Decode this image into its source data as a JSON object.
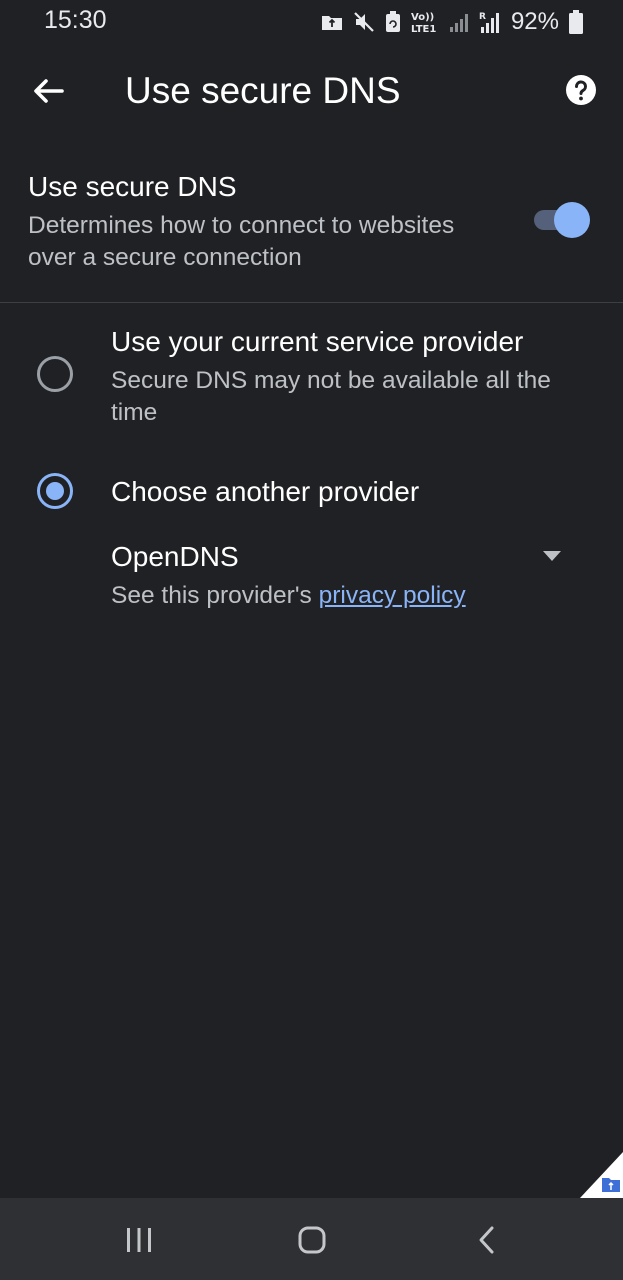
{
  "status_bar": {
    "time": "15:30",
    "battery_percent": "92%",
    "network_label_top": "Vo))",
    "network_label_bottom": "LTE1",
    "roaming_label": "R",
    "icons": [
      "notification-app-icon",
      "mute-icon",
      "battery-saver-icon",
      "volte-icon",
      "signal-sim1-icon",
      "signal-sim2-icon",
      "battery-icon"
    ]
  },
  "app_bar": {
    "title": "Use secure DNS",
    "back_icon": "arrow-back-icon",
    "help_icon": "help-icon"
  },
  "secure_dns": {
    "title": "Use secure DNS",
    "description": "Determines how to connect to websites over a secure connection",
    "enabled": true
  },
  "options": [
    {
      "label": "Use your current service provider",
      "description": "Secure DNS may not be available all the time",
      "selected": false
    },
    {
      "label": "Choose another provider",
      "selected": true
    }
  ],
  "provider": {
    "selected": "OpenDNS",
    "note_prefix": "See this provider's ",
    "link_text": "privacy policy"
  },
  "nav_bar": {
    "buttons": [
      "recents-icon",
      "home-icon",
      "back-icon"
    ]
  },
  "colors": {
    "background": "#202124",
    "accent": "#8ab4f8",
    "nav_bar": "#2f3033",
    "secondary_text": "#bdc1c6"
  }
}
